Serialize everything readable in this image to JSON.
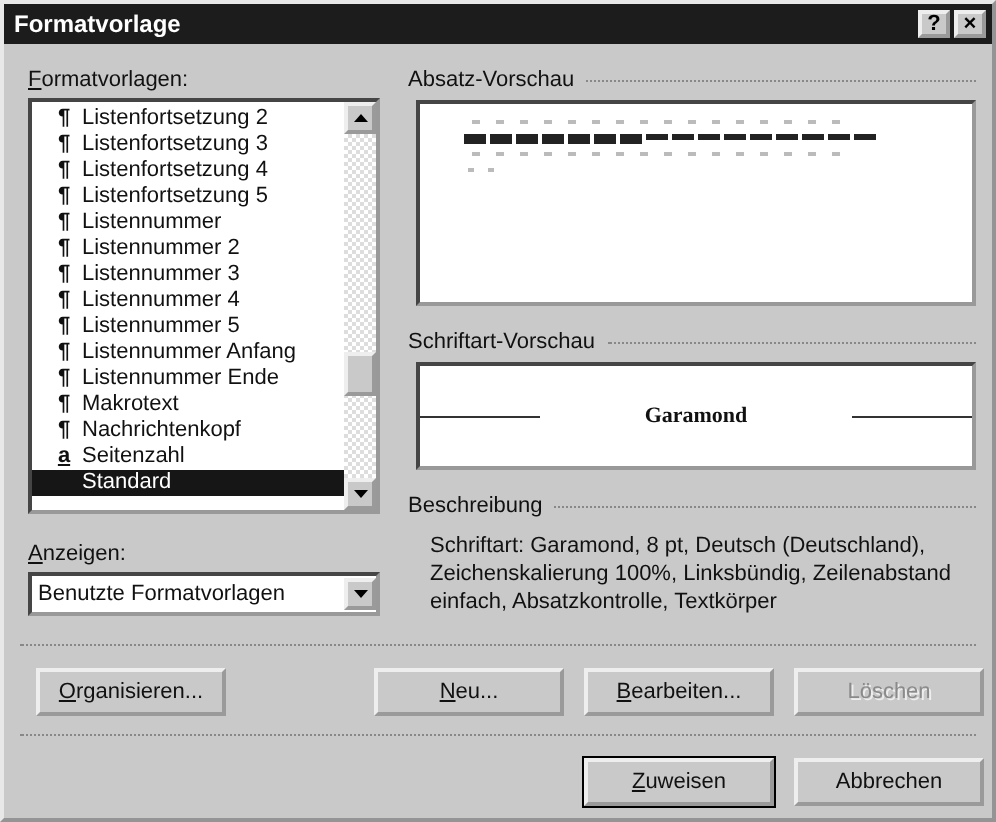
{
  "window": {
    "title": "Formatvorlage",
    "controls": [
      "?",
      "×"
    ]
  },
  "styles": {
    "label": "Formatvorlagen:",
    "underline_first": true,
    "items": [
      {
        "mark": "¶",
        "label": "Listenfortsetzung 2",
        "selected": false
      },
      {
        "mark": "¶",
        "label": "Listenfortsetzung 3",
        "selected": false
      },
      {
        "mark": "¶",
        "label": "Listenfortsetzung 4",
        "selected": false
      },
      {
        "mark": "¶",
        "label": "Listenfortsetzung 5",
        "selected": false
      },
      {
        "mark": "¶",
        "label": "Listennummer",
        "selected": false
      },
      {
        "mark": "¶",
        "label": "Listennummer 2",
        "selected": false
      },
      {
        "mark": "¶",
        "label": "Listennummer 3",
        "selected": false
      },
      {
        "mark": "¶",
        "label": "Listennummer 4",
        "selected": false
      },
      {
        "mark": "¶",
        "label": "Listennummer 5",
        "selected": false
      },
      {
        "mark": "¶",
        "label": "Listennummer Anfang",
        "selected": false
      },
      {
        "mark": "¶",
        "label": "Listennummer Ende",
        "selected": false
      },
      {
        "mark": "¶",
        "label": "Makrotext",
        "selected": false
      },
      {
        "mark": "¶",
        "label": "Nachrichtenkopf",
        "selected": false
      },
      {
        "mark": "a",
        "label": "Seitenzahl",
        "selected": false
      },
      {
        "label": "Standard",
        "selected": true
      }
    ]
  },
  "show": {
    "label": "Anzeigen:",
    "underline_first": true,
    "value": "Benutzte Formatvorlagen"
  },
  "paragraph_preview": {
    "label": "Absatz-Vorschau"
  },
  "font_preview": {
    "label": "Schriftart-Vorschau",
    "sample": "Garamond"
  },
  "description": {
    "label": "Beschreibung",
    "text": "Schriftart: Garamond, 8 pt, Deutsch (Deutschland), Zeichenskalierung 100%, Linksbündig, Zeilenabstand einfach, Absatzkontrolle, Textkörper"
  },
  "buttons": [
    {
      "label": "Organisieren...",
      "underline_first": true,
      "disabled": false,
      "default": false
    },
    {
      "label": "Neu...",
      "underline_first": true,
      "disabled": false,
      "default": false
    },
    {
      "label": "Bearbeiten...",
      "underline_first": true,
      "disabled": false,
      "default": false
    },
    {
      "label": "Löschen",
      "underline_first": false,
      "disabled": true,
      "default": false
    }
  ],
  "footer_buttons": [
    {
      "label": "Zuweisen",
      "underline_first": true,
      "disabled": false,
      "default": true
    },
    {
      "label": "Abbrechen",
      "underline_first": false,
      "disabled": false,
      "default": false
    }
  ]
}
